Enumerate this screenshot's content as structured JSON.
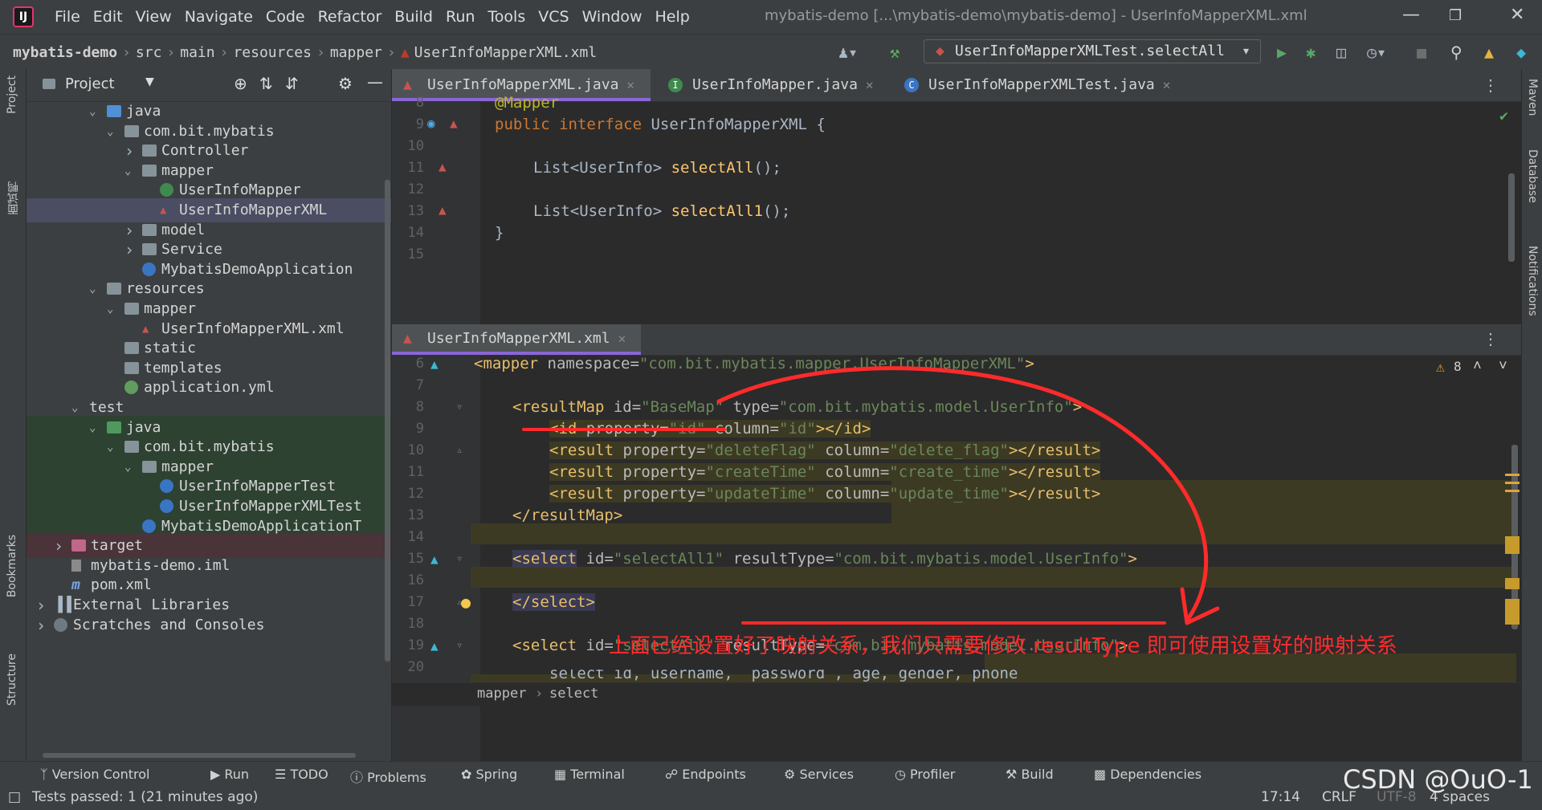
{
  "menu": {
    "items": [
      "File",
      "Edit",
      "View",
      "Navigate",
      "Code",
      "Refactor",
      "Build",
      "Run",
      "Tools",
      "VCS",
      "Window",
      "Help"
    ],
    "window_title": "mybatis-demo [...\\mybatis-demo\\mybatis-demo] - UserInfoMapperXML.xml"
  },
  "breadcrumb": [
    "mybatis-demo",
    "src",
    "main",
    "resources",
    "mapper",
    "UserInfoMapperXML.xml"
  ],
  "run_config": "UserInfoMapperXMLTest.selectAll",
  "left_strip": [
    "Project",
    "面试鸭",
    "Bookmarks",
    "Structure"
  ],
  "right_strip": [
    "Maven",
    "Database",
    "Notifications"
  ],
  "project_panel": {
    "title": "Project",
    "tree": [
      {
        "label": "java",
        "depth": 3,
        "arrow": "v",
        "icon": "folder-blue"
      },
      {
        "label": "com.bit.mybatis",
        "depth": 4,
        "arrow": "v",
        "icon": "package"
      },
      {
        "label": "Controller",
        "depth": 5,
        "arrow": ">",
        "icon": "package"
      },
      {
        "label": "mapper",
        "depth": 5,
        "arrow": "v",
        "icon": "package"
      },
      {
        "label": "UserInfoMapper",
        "depth": 6,
        "arrow": "",
        "icon": "interface"
      },
      {
        "label": "UserInfoMapperXML",
        "depth": 6,
        "arrow": "",
        "icon": "mapper",
        "selected": true
      },
      {
        "label": "model",
        "depth": 5,
        "arrow": ">",
        "icon": "package"
      },
      {
        "label": "Service",
        "depth": 5,
        "arrow": ">",
        "icon": "package"
      },
      {
        "label": "MybatisDemoApplication",
        "depth": 5,
        "arrow": "",
        "icon": "class-spring"
      },
      {
        "label": "resources",
        "depth": 3,
        "arrow": "v",
        "icon": "folder-res"
      },
      {
        "label": "mapper",
        "depth": 4,
        "arrow": "v",
        "icon": "folder"
      },
      {
        "label": "UserInfoMapperXML.xml",
        "depth": 5,
        "arrow": "",
        "icon": "xml"
      },
      {
        "label": "static",
        "depth": 4,
        "arrow": "",
        "icon": "folder"
      },
      {
        "label": "templates",
        "depth": 4,
        "arrow": "",
        "icon": "folder"
      },
      {
        "label": "application.yml",
        "depth": 4,
        "arrow": "",
        "icon": "yml"
      },
      {
        "label": "test",
        "depth": 2,
        "arrow": "v",
        "icon": "none"
      },
      {
        "label": "java",
        "depth": 3,
        "arrow": "v",
        "icon": "folder-green",
        "test": true
      },
      {
        "label": "com.bit.mybatis",
        "depth": 4,
        "arrow": "v",
        "icon": "package",
        "test": true
      },
      {
        "label": "mapper",
        "depth": 5,
        "arrow": "v",
        "icon": "package",
        "test": true
      },
      {
        "label": "UserInfoMapperTest",
        "depth": 6,
        "arrow": "",
        "icon": "class",
        "test": true
      },
      {
        "label": "UserInfoMapperXMLTest",
        "depth": 6,
        "arrow": "",
        "icon": "class",
        "test": true
      },
      {
        "label": "MybatisDemoApplicationT",
        "depth": 5,
        "arrow": "",
        "icon": "class-spring",
        "test": true
      },
      {
        "label": "target",
        "depth": 1,
        "arrow": ">",
        "icon": "folder-pink",
        "excluded": true
      },
      {
        "label": "mybatis-demo.iml",
        "depth": 1,
        "arrow": "",
        "icon": "iml"
      },
      {
        "label": "pom.xml",
        "depth": 1,
        "arrow": "",
        "icon": "maven"
      },
      {
        "label": "External Libraries",
        "depth": 0,
        "arrow": ">",
        "icon": "lib"
      },
      {
        "label": "Scratches and Consoles",
        "depth": 0,
        "arrow": ">",
        "icon": "scratch"
      }
    ]
  },
  "editor_top": {
    "tabs": [
      {
        "label": "UserInfoMapperXML.java",
        "active": true
      },
      {
        "label": "UserInfoMapper.java",
        "active": false
      },
      {
        "label": "UserInfoMapperXMLTest.java",
        "active": false
      }
    ],
    "line_numbers": [
      "8",
      "9",
      "10",
      "11",
      "12",
      "13",
      "14",
      "15"
    ],
    "lines": {
      "l8": "@Mapper",
      "l9_kw": "public interface ",
      "l9_name": "UserInfoMapperXML {",
      "l11_type": "List<UserInfo> ",
      "l11_fn": "selectAll",
      "l11_end": "();",
      "l13_type": "List<UserInfo> ",
      "l13_fn": "selectAll1",
      "l13_end": "();",
      "l14": "}"
    }
  },
  "editor_bottom": {
    "tab": "UserInfoMapperXML.xml",
    "warnings": "8",
    "line_numbers": [
      "6",
      "7",
      "8",
      "9",
      "10",
      "11",
      "12",
      "13",
      "14",
      "15",
      "16",
      "17",
      "18",
      "19",
      "20"
    ],
    "breadcrumb": [
      "mapper",
      "select"
    ],
    "code": {
      "l6": [
        "<mapper",
        " namespace=",
        "\"com.bit.mybatis.mapper.UserInfoMapperXML\"",
        ">"
      ],
      "l8": [
        "<resultMap",
        " id=",
        "\"BaseMap\"",
        " type=",
        "\"com.bit.mybatis.model.UserInfo\"",
        ">"
      ],
      "l9": [
        "<id",
        " property=",
        "\"id\"",
        " column=",
        "\"id\"",
        "></id>"
      ],
      "l10": [
        "<result",
        " property=",
        "\"deleteFlag\"",
        " column=",
        "\"delete_flag\"",
        "></result>"
      ],
      "l11": [
        "<result",
        " property=",
        "\"createTime\"",
        " column=",
        "\"create_time\"",
        "></result>"
      ],
      "l12": [
        "<result",
        " property=",
        "\"updateTime\"",
        " column=",
        "\"update_time\"",
        "></result>"
      ],
      "l13": "</resultMap>",
      "l15": [
        "<select",
        " id=",
        "\"selectAll1\"",
        " resultType=",
        "\"com.bit.mybatis.model.UserInfo\"",
        ">"
      ],
      "l17": "</select>",
      "l19": [
        "<select",
        " id=",
        "\"selectAll\"",
        " resultType=",
        "\"com.bit.mybatis.model.UserInfo\"",
        ">"
      ],
      "l20": "select id, username, `password`, age, gender, phone"
    }
  },
  "annotation": "上面已经设置好了映射关系，我们只需要修改 resultType 即可使用设置好的映射关系",
  "bottom_tools": [
    "Version Control",
    "Run",
    "TODO",
    "Problems",
    "Spring",
    "Terminal",
    "Endpoints",
    "Services",
    "Profiler",
    "Build",
    "Dependencies"
  ],
  "status": {
    "message": "Tests passed: 1 (21 minutes ago)",
    "position": "17:14",
    "line_sep": "CRLF",
    "encoding": "UTF-8",
    "indent": "4 spaces"
  },
  "watermark": "CSDN @OuO-1",
  "colors": {
    "annotation_red": "#ff2b2b",
    "accent_purple": "#8a66d6"
  }
}
